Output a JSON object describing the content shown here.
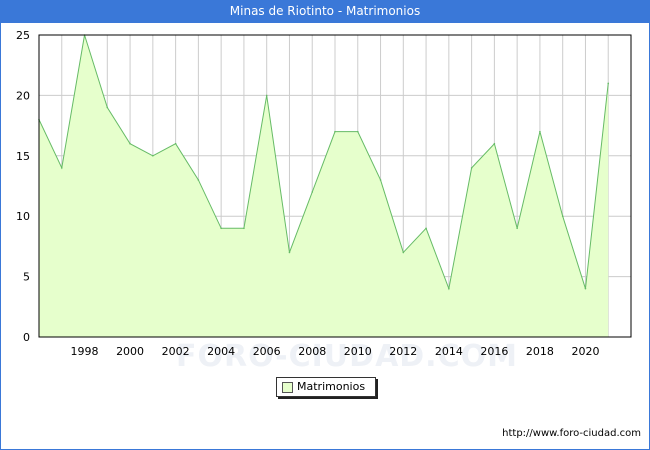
{
  "header": {
    "title": "Minas de Riotinto - Matrimonios"
  },
  "watermark": "FORO-CIUDAD.COM",
  "source_url": "http://www.foro-ciudad.com",
  "chart_data": {
    "type": "area",
    "title": "Minas de Riotinto - Matrimonios",
    "x": [
      1996,
      1997,
      1998,
      1999,
      2000,
      2001,
      2002,
      2003,
      2004,
      2005,
      2006,
      2007,
      2008,
      2009,
      2010,
      2011,
      2012,
      2013,
      2014,
      2015,
      2016,
      2017,
      2018,
      2019,
      2020,
      2021
    ],
    "series": [
      {
        "name": "Matrimonios",
        "values": [
          18,
          14,
          25,
          19,
          16,
          15,
          16,
          13,
          9,
          9,
          20,
          7,
          12,
          17,
          17,
          13,
          7,
          9,
          4,
          14,
          16,
          9,
          17,
          10,
          4,
          21
        ]
      }
    ],
    "xticks": [
      "1998",
      "2000",
      "2002",
      "2004",
      "2006",
      "2008",
      "2010",
      "2012",
      "2014",
      "2016",
      "2018",
      "2020"
    ],
    "yticks": [
      "0",
      "5",
      "10",
      "15",
      "20",
      "25"
    ],
    "xlim": [
      1996,
      2022
    ],
    "ylim": [
      0,
      25
    ],
    "grid": true,
    "legend_position": "bottom-center",
    "colors": {
      "fill": "#e6ffcc",
      "line": "#66bb66",
      "grid": "#cccccc",
      "header": "#3a78d8"
    }
  }
}
